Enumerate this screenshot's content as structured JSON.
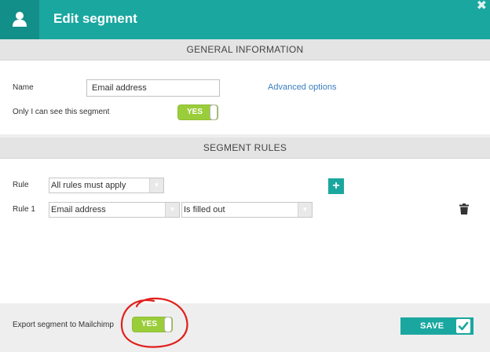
{
  "header": {
    "title": "Edit segment",
    "close_glyph": "✖",
    "avatar_icon": "user-icon"
  },
  "general": {
    "section_title": "GENERAL INFORMATION",
    "name_label": "Name",
    "name_value": "Email address",
    "advanced_link": "Advanced options",
    "private_label": "Only I can see this segment",
    "private_toggle": "YES"
  },
  "rules": {
    "section_title": "SEGMENT RULES",
    "rule_label": "Rule",
    "rule_mode": "All rules must apply",
    "add_glyph": "+",
    "items": [
      {
        "label": "Rule 1",
        "field": "Email address",
        "operator": "Is filled out"
      }
    ]
  },
  "footer": {
    "export_label": "Export segment to Mailchimp",
    "export_toggle": "YES",
    "save_label": "SAVE"
  },
  "colors": {
    "accent": "#1aa7a0",
    "toggle_green": "#9acd3a",
    "annotation_red": "#e0201c"
  }
}
